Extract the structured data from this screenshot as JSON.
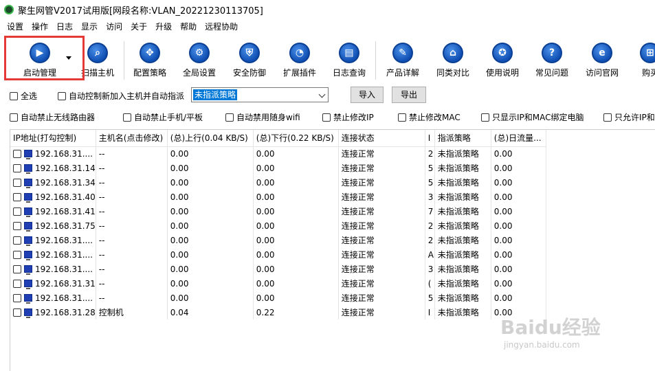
{
  "title": "聚生网管V2017试用版[网段名称:VLAN_20221230113705]",
  "menu": [
    "设置",
    "操作",
    "日志",
    "显示",
    "访问",
    "关于",
    "升级",
    "帮助",
    "远程协助"
  ],
  "toolbar": {
    "buttons": [
      {
        "label": "启动管理",
        "icon": "play-icon"
      },
      {
        "label": "扫描主机",
        "icon": "search-icon"
      },
      {
        "label": "配置策略",
        "icon": "move-icon"
      },
      {
        "label": "全局设置",
        "icon": "gear-icon"
      },
      {
        "label": "安全防御",
        "icon": "shield-icon"
      },
      {
        "label": "扩展插件",
        "icon": "pie-icon"
      },
      {
        "label": "日志查询",
        "icon": "log-icon"
      },
      {
        "label": "产品详解",
        "icon": "edit-icon"
      },
      {
        "label": "同类对比",
        "icon": "graduation-icon"
      },
      {
        "label": "使用说明",
        "icon": "award-icon"
      },
      {
        "label": "常见问题",
        "icon": "question-icon"
      },
      {
        "label": "访问官网",
        "icon": "ie-icon"
      },
      {
        "label": "购买",
        "icon": "cart-icon"
      }
    ]
  },
  "controls": {
    "select_all": "全选",
    "auto_control": "自动控制新加入主机并自动指派",
    "policy_value": "未指派策略",
    "import": "导入",
    "export": "导出"
  },
  "options": [
    "自动禁止无线路由器",
    "自动禁止手机/平板",
    "自动禁用随身wifi",
    "禁止修改IP",
    "禁止修改MAC",
    "只显示IP和MAC绑定电脑",
    "只允许IP和"
  ],
  "table": {
    "headers": [
      "IP地址(打勾控制)",
      "主机名(点击修改)",
      "(总)上行(0.04 KB/S)",
      "(总)下行(0.22 KB/S)",
      "连接状态",
      "I",
      "指派策略",
      "(总)日流量..."
    ],
    "rows": [
      [
        "192.168.31....",
        "--",
        "0.00",
        "0.00",
        "连接正常",
        "2",
        "未指派策略",
        "0.00"
      ],
      [
        "192.168.31.14",
        "--",
        "0.00",
        "0.00",
        "连接正常",
        "5",
        "未指派策略",
        "0.00"
      ],
      [
        "192.168.31.34",
        "--",
        "0.00",
        "0.00",
        "连接正常",
        "5",
        "未指派策略",
        "0.00"
      ],
      [
        "192.168.31.40",
        "--",
        "0.00",
        "0.00",
        "连接正常",
        "3",
        "未指派策略",
        "0.00"
      ],
      [
        "192.168.31.41",
        "--",
        "0.00",
        "0.00",
        "连接正常",
        "7",
        "未指派策略",
        "0.00"
      ],
      [
        "192.168.31.75",
        "--",
        "0.00",
        "0.00",
        "连接正常",
        "2",
        "未指派策略",
        "0.00"
      ],
      [
        "192.168.31....",
        "--",
        "0.00",
        "0.00",
        "连接正常",
        "2",
        "未指派策略",
        "0.00"
      ],
      [
        "192.168.31....",
        "--",
        "0.00",
        "0.00",
        "连接正常",
        "A",
        "未指派策略",
        "0.00"
      ],
      [
        "192.168.31....",
        "--",
        "0.00",
        "0.00",
        "连接正常",
        "3",
        "未指派策略",
        "0.00"
      ],
      [
        "192.168.31.31",
        "--",
        "0.00",
        "0.00",
        "连接正常",
        "(",
        "未指派策略",
        "0.00"
      ],
      [
        "192.168.31....",
        "--",
        "0.00",
        "0.00",
        "连接正常",
        "5",
        "未指派策略",
        "0.00"
      ],
      [
        "192.168.31.28",
        "控制机",
        "0.04",
        "0.22",
        "连接正常",
        "I",
        "未指派策略",
        "0.00"
      ]
    ]
  },
  "watermark": {
    "main": "Baidu经验",
    "sub": "jingyan.baidu.com"
  },
  "colors": {
    "highlight": "#e53935",
    "selection": "#0078d7",
    "icon_blue": "#0f4fb3"
  }
}
